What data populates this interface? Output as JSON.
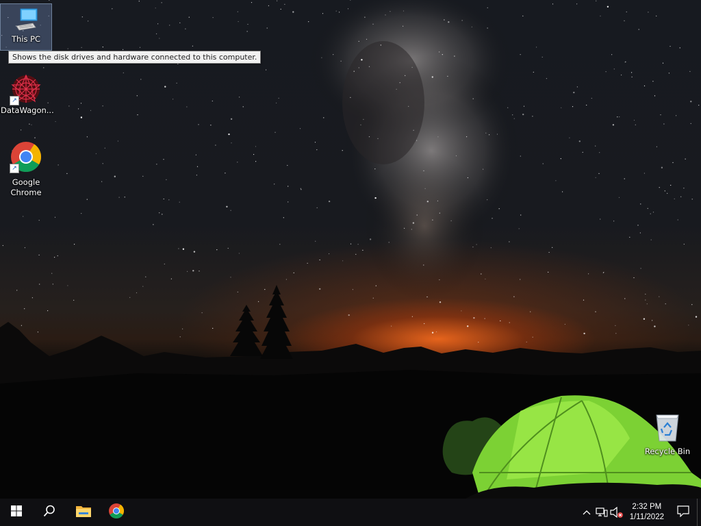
{
  "desktop": {
    "icons": [
      {
        "name": "This PC",
        "icon": "computer-icon",
        "selected": true
      },
      {
        "name": "DataWagon...",
        "icon": "datawagon-icon",
        "shortcut": true
      },
      {
        "name": "Google Chrome",
        "line1": "Google",
        "line2": "Chrome",
        "icon": "chrome-icon",
        "shortcut": true
      },
      {
        "name": "Recycle Bin",
        "icon": "recycle-bin-icon"
      }
    ],
    "tooltip": "Shows the disk drives and hardware connected to this computer."
  },
  "taskbar": {
    "start": "start-icon",
    "search": "search-icon",
    "pinned": [
      {
        "name": "File Explorer",
        "icon": "folder-icon"
      },
      {
        "name": "Google Chrome",
        "icon": "chrome-icon"
      }
    ],
    "tray": {
      "chevron": "chevron-up-icon",
      "network": "network-icon",
      "volume": "volume-muted-icon",
      "time": "2:32 PM",
      "date": "1/11/2022",
      "notifications": "action-center-icon"
    }
  },
  "colors": {
    "taskbar_bg": "#0f0f12",
    "tent_green": "#8fe23a",
    "horizon_glow": "#ff6e1e",
    "tooltip_bg": "#f1f1f1"
  }
}
